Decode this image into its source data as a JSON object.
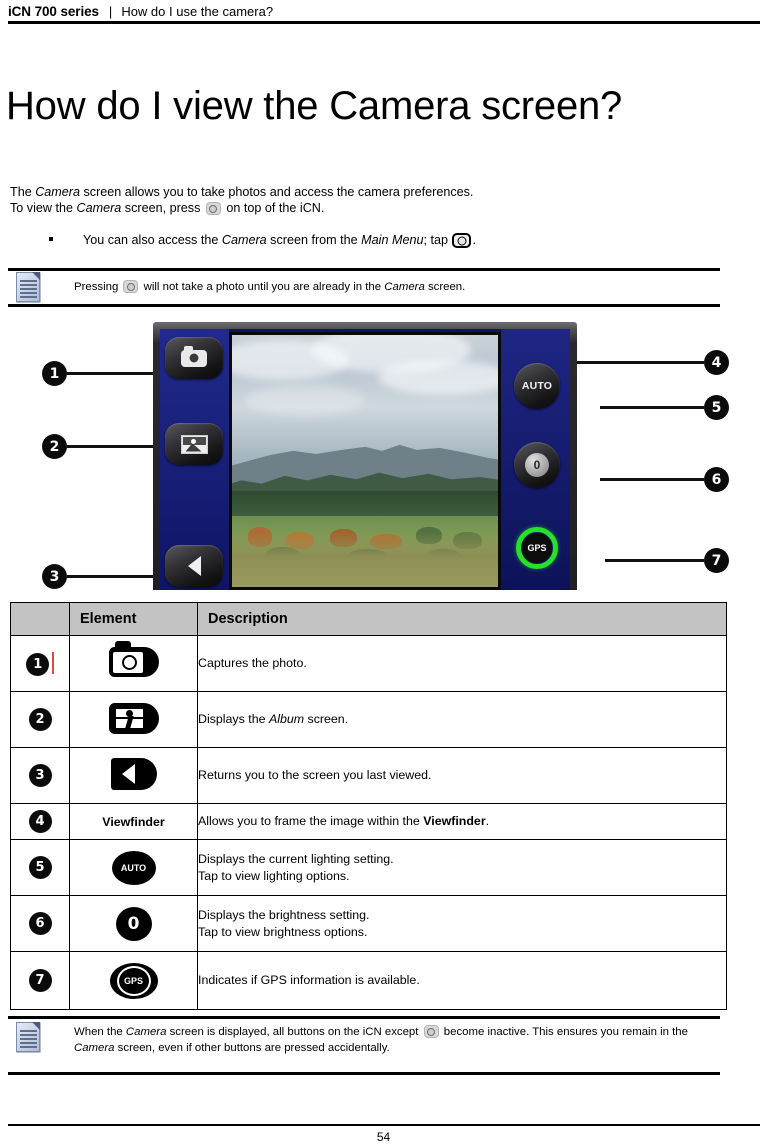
{
  "header": {
    "series": "iCN 700 series",
    "separator": "|",
    "topic": "How do I use the camera?"
  },
  "title": "How do I view the Camera screen?",
  "intro": {
    "line1_a": "The ",
    "line1_italic": "Camera",
    "line1_b": " screen allows you to take photos and access the camera preferences.",
    "line2_a": "To view the ",
    "line2_italic": "Camera",
    "line2_b": " screen, press ",
    "line2_c": " on top of the iCN."
  },
  "bullet": {
    "a": "You can also access the ",
    "italic1": "Camera",
    "b": " screen from the ",
    "italic2": "Main Menu",
    "c": "; tap ",
    "d": "."
  },
  "note_top": {
    "a": "Pressing ",
    "b": " will not take a photo until you are already in the ",
    "italic": "Camera",
    "c": " screen."
  },
  "note_bottom": {
    "a": "When the ",
    "italic1": "Camera",
    "b": " screen is displayed, all buttons on the iCN except ",
    "c": " become inactive. This ensures you remain in the ",
    "italic2": "Camera",
    "d": " screen, even if other buttons are pressed accidentally."
  },
  "figure": {
    "callouts": [
      "1",
      "2",
      "3",
      "4",
      "5",
      "6",
      "7"
    ],
    "camera_ui": {
      "auto_label": "AUTO",
      "ev_label": "0",
      "gps_label": "GPS"
    },
    "colors": {
      "screen_blue": "#121a7e",
      "bezel": "#202024",
      "gps_green": "#27e02a"
    }
  },
  "table": {
    "headers": [
      "",
      "Element",
      "Description"
    ],
    "rows": [
      {
        "num": "1",
        "icon": "camera-shutter-icon",
        "element_text": "",
        "desc_a": "Captures the photo.",
        "desc_italic": "",
        "desc_b": "",
        "desc_line2": ""
      },
      {
        "num": "2",
        "icon": "album-icon",
        "element_text": "",
        "desc_a": "Displays the ",
        "desc_italic": "Album",
        "desc_b": " screen.",
        "desc_line2": ""
      },
      {
        "num": "3",
        "icon": "back-arrow-icon",
        "element_text": "",
        "desc_a": "Returns you to the screen you last viewed.",
        "desc_italic": "",
        "desc_b": "",
        "desc_line2": ""
      },
      {
        "num": "4",
        "icon": "",
        "element_text": "Viewfinder",
        "desc_a": "Allows you to frame the image within the ",
        "desc_bold": "Viewfinder",
        "desc_b": ".",
        "desc_line2": ""
      },
      {
        "num": "5",
        "icon": "auto-lighting-icon",
        "element_text": "",
        "desc_a": "Displays the current lighting setting.",
        "desc_line2": "Tap to view lighting options."
      },
      {
        "num": "6",
        "icon": "brightness-icon",
        "element_text": "",
        "desc_a": "Displays the brightness setting.",
        "desc_line2": "Tap to view brightness options."
      },
      {
        "num": "7",
        "icon": "gps-icon",
        "element_text": "",
        "desc_a": "Indicates if GPS information is available.",
        "desc_line2": ""
      }
    ],
    "icon_labels": {
      "auto": "AUTO",
      "brightness": "0",
      "gps": "GPS"
    }
  },
  "footer": {
    "page_number": "54"
  }
}
